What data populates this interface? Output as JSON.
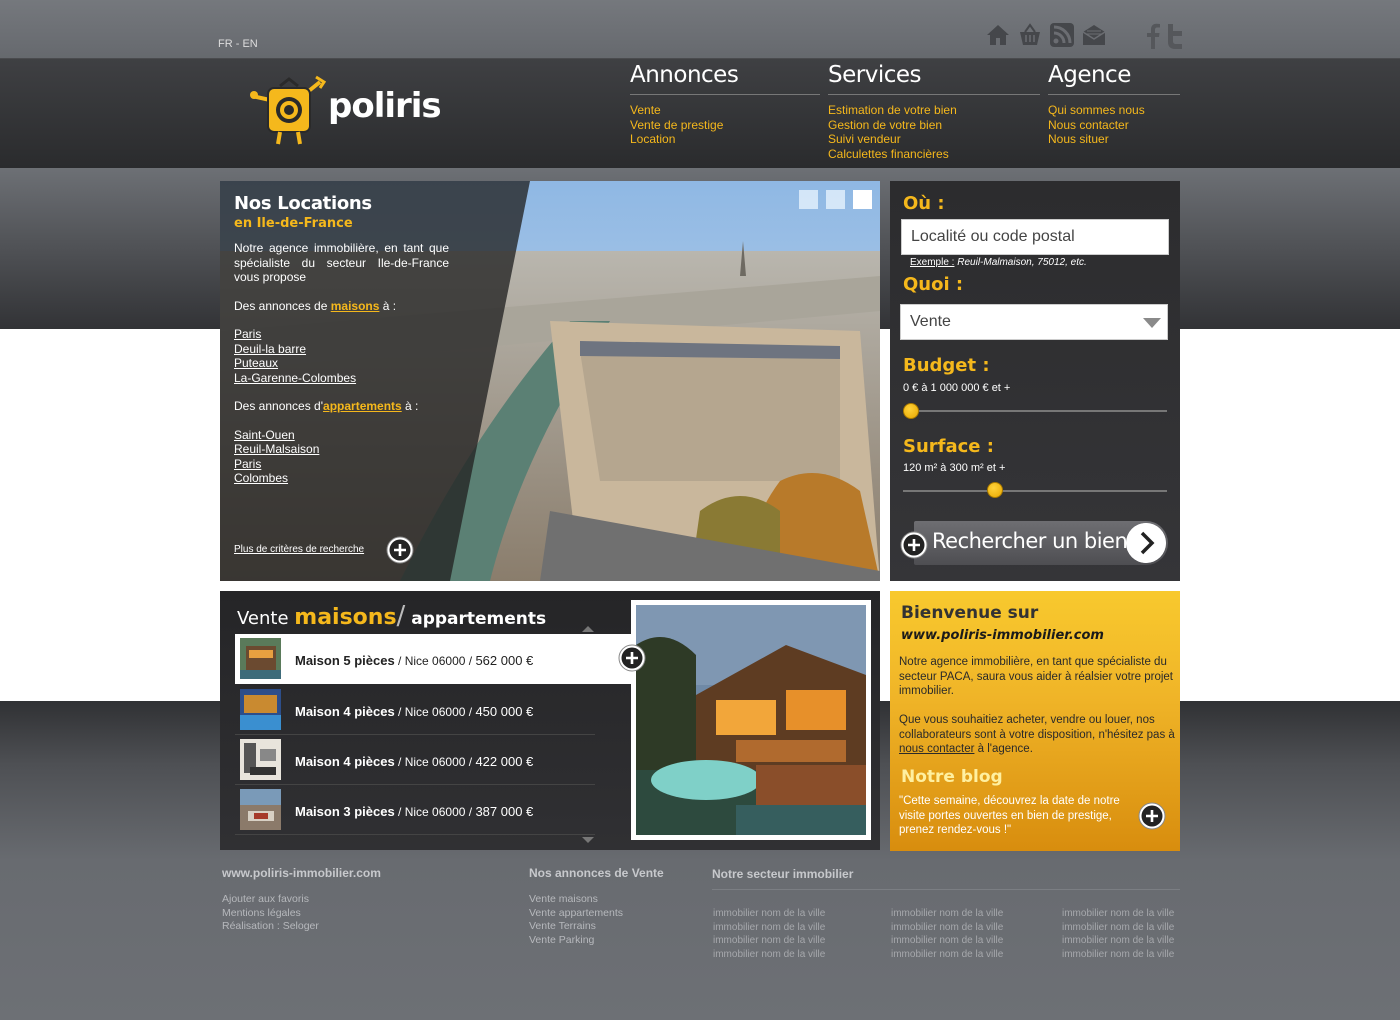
{
  "lang": "FR - EN",
  "top_icons": [
    "home-icon",
    "basket-icon",
    "rss-icon",
    "mail-icon"
  ],
  "social_icons": [
    "facebook-icon",
    "twitter-icon"
  ],
  "logo": {
    "text": "poliris"
  },
  "nav": [
    {
      "title": "Annonces",
      "items": [
        "Vente",
        "Vente de prestige",
        "Location"
      ]
    },
    {
      "title": "Services",
      "items": [
        "Estimation de votre bien",
        "Gestion de  votre bien",
        "Suivi vendeur",
        "Calculettes financières"
      ]
    },
    {
      "title": "Agence",
      "items": [
        "Qui sommes nous",
        "Nous contacter",
        "Nous situer"
      ]
    }
  ],
  "hero": {
    "title": "Nos Locations",
    "subtitle": "en Ile-de-France",
    "intro": "Notre agence immobilière, en tant que spécialiste du secteur Ile-de-France vous propose",
    "houses_prefix": "Des annonces de ",
    "houses_word": "maisons",
    "houses_suffix": " à :",
    "houses_links": [
      "Paris",
      "Deuil-la barre",
      "Puteaux",
      "La-Garenne-Colombes"
    ],
    "apts_prefix": "Des annonces d'",
    "apts_word": "appartements",
    "apts_suffix": " à :",
    "apts_links": [
      "Saint-Ouen",
      "Reuil-Malsaison",
      "Paris",
      "Colombes"
    ],
    "more_link": "Plus de critères de recherche",
    "slides": 3,
    "active_slide": 3
  },
  "search": {
    "where_label": "Où :",
    "where_placeholder": "Localité ou code postal",
    "example_label": "Exemple :",
    "example_text": " Reuil-Malmaison, 75012, etc.",
    "what_label": "Quoi :",
    "what_value": "Vente",
    "budget_label": "Budget :",
    "budget_range": "0 € à 1 000 000 € et +",
    "budget_level": 0.03,
    "surface_label": "Surface :",
    "surface_range": "120 m² à 300 m² et +",
    "surface_level": 0.35,
    "button_label": "Rechercher un bien"
  },
  "listings": {
    "title_vente": "Vente ",
    "title_maisons": "maisons",
    "title_slash": "/",
    "title_apts": " appartements",
    "items": [
      {
        "type": "Maison 5 pièces",
        "location": " / Nice 06000 / ",
        "price": "562 000 €"
      },
      {
        "type": "Maison 4 pièces",
        "location": " / Nice 06000 / ",
        "price": "450 000 €"
      },
      {
        "type": "Maison 4 pièces",
        "location": " / Nice 06000 / ",
        "price": "422 000 €"
      },
      {
        "type": "Maison 3 pièces",
        "location": " / Nice 06000 / ",
        "price": "387 000 €"
      }
    ]
  },
  "welcome": {
    "title": "Bienvenue sur",
    "url": "www.poliris-immobilier.com",
    "p1": "Notre agence immobilière, en tant que spécialiste du secteur PACA, saura vous aider à réalsier votre projet immobilier.",
    "p2_before": "Que vous souhaitiez acheter, vendre ou louer, nos collaborateurs sont à votre disposition, n'hésitez pas à ",
    "p2_link": "nous contacter",
    "p2_after": " à l'agence.",
    "blog_title": "Notre blog",
    "blog_quote": "\"Cette semaine, découvrez la date de notre visite portes ouvertes en bien de prestige, prenez rendez-vous !\""
  },
  "footer": {
    "site": {
      "title": "www.poliris-immobilier.com",
      "links": [
        "Ajouter aux favoris",
        "Mentions légales",
        "Réalisation : Seloger"
      ]
    },
    "sales": {
      "title": "Nos annonces de Vente",
      "links": [
        "Vente maisons",
        "Vente appartements",
        "Vente Terrains",
        "Vente Parking"
      ]
    },
    "sector": {
      "title": "Notre secteur immobilier",
      "columns": [
        [
          "immobilier nom de la ville",
          "immobilier nom de la ville",
          "immobilier nom de la ville",
          "immobilier nom de la ville"
        ],
        [
          "immobilier nom de la ville",
          "immobilier nom de la ville",
          "immobilier nom de la ville",
          "immobilier nom de la ville"
        ],
        [
          "immobilier nom de la ville",
          "immobilier nom de la ville",
          "immobilier nom de la ville",
          "immobilier nom de la ville"
        ]
      ]
    }
  },
  "colors": {
    "accent": "#f5b81c",
    "dark": "#2c2c2e",
    "yellow_panel": "#f0b528"
  }
}
